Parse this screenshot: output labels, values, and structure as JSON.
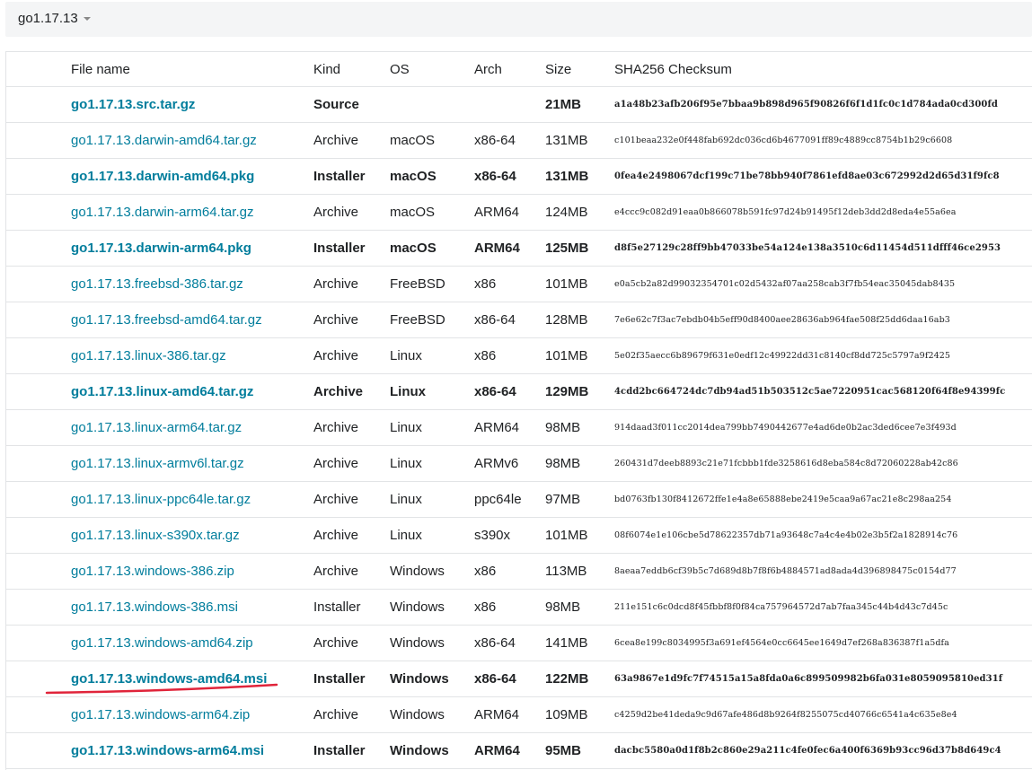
{
  "version_selector": {
    "label": "go1.17.13"
  },
  "table": {
    "headers": {
      "file_name": "File name",
      "kind": "Kind",
      "os": "OS",
      "arch": "Arch",
      "size": "Size",
      "checksum": "SHA256 Checksum"
    },
    "rows": [
      {
        "file": "go1.17.13.src.tar.gz",
        "kind": "Source",
        "os": "",
        "arch": "",
        "size": "21MB",
        "sha": "a1a48b23afb206f95e7bbaa9b898d965f90826f6f1d1fc0c1d784ada0cd300fd",
        "featured": true
      },
      {
        "file": "go1.17.13.darwin-amd64.tar.gz",
        "kind": "Archive",
        "os": "macOS",
        "arch": "x86-64",
        "size": "131MB",
        "sha": "c101beaa232e0f448fab692dc036cd6b4677091ff89c4889cc8754b1b29c6608",
        "featured": false
      },
      {
        "file": "go1.17.13.darwin-amd64.pkg",
        "kind": "Installer",
        "os": "macOS",
        "arch": "x86-64",
        "size": "131MB",
        "sha": "0fea4e2498067dcf199c71be78bb940f7861efd8ae03c672992d2d65d31f9fc8",
        "featured": true
      },
      {
        "file": "go1.17.13.darwin-arm64.tar.gz",
        "kind": "Archive",
        "os": "macOS",
        "arch": "ARM64",
        "size": "124MB",
        "sha": "e4ccc9c082d91eaa0b866078b591fc97d24b91495f12deb3dd2d8eda4e55a6ea",
        "featured": false
      },
      {
        "file": "go1.17.13.darwin-arm64.pkg",
        "kind": "Installer",
        "os": "macOS",
        "arch": "ARM64",
        "size": "125MB",
        "sha": "d8f5e27129c28ff9bb47033be54a124e138a3510c6d11454d511dfff46ce2953",
        "featured": true
      },
      {
        "file": "go1.17.13.freebsd-386.tar.gz",
        "kind": "Archive",
        "os": "FreeBSD",
        "arch": "x86",
        "size": "101MB",
        "sha": "e0a5cb2a82d99032354701c02d5432af07aa258cab3f7fb54eac35045dab8435",
        "featured": false
      },
      {
        "file": "go1.17.13.freebsd-amd64.tar.gz",
        "kind": "Archive",
        "os": "FreeBSD",
        "arch": "x86-64",
        "size": "128MB",
        "sha": "7e6e62c7f3ac7ebdb04b5eff90d8400aee28636ab964fae508f25dd6daa16ab3",
        "featured": false
      },
      {
        "file": "go1.17.13.linux-386.tar.gz",
        "kind": "Archive",
        "os": "Linux",
        "arch": "x86",
        "size": "101MB",
        "sha": "5e02f35aecc6b89679f631e0edf12c49922dd31c8140cf8dd725c5797a9f2425",
        "featured": false
      },
      {
        "file": "go1.17.13.linux-amd64.tar.gz",
        "kind": "Archive",
        "os": "Linux",
        "arch": "x86-64",
        "size": "129MB",
        "sha": "4cdd2bc664724dc7db94ad51b503512c5ae7220951cac568120f64f8e94399fc",
        "featured": true
      },
      {
        "file": "go1.17.13.linux-arm64.tar.gz",
        "kind": "Archive",
        "os": "Linux",
        "arch": "ARM64",
        "size": "98MB",
        "sha": "914daad3f011cc2014dea799bb7490442677e4ad6de0b2ac3ded6cee7e3f493d",
        "featured": false
      },
      {
        "file": "go1.17.13.linux-armv6l.tar.gz",
        "kind": "Archive",
        "os": "Linux",
        "arch": "ARMv6",
        "size": "98MB",
        "sha": "260431d7deeb8893c21e71fcbbb1fde3258616d8eba584c8d72060228ab42c86",
        "featured": false
      },
      {
        "file": "go1.17.13.linux-ppc64le.tar.gz",
        "kind": "Archive",
        "os": "Linux",
        "arch": "ppc64le",
        "size": "97MB",
        "sha": "bd0763fb130f8412672ffe1e4a8e65888ebe2419e5caa9a67ac21e8c298aa254",
        "featured": false
      },
      {
        "file": "go1.17.13.linux-s390x.tar.gz",
        "kind": "Archive",
        "os": "Linux",
        "arch": "s390x",
        "size": "101MB",
        "sha": "08f6074e1e106cbe5d78622357db71a93648c7a4c4e4b02e3b5f2a1828914c76",
        "featured": false
      },
      {
        "file": "go1.17.13.windows-386.zip",
        "kind": "Archive",
        "os": "Windows",
        "arch": "x86",
        "size": "113MB",
        "sha": "8aeaa7eddb6cf39b5c7d689d8b7f8f6b4884571ad8ada4d396898475c0154d77",
        "featured": false
      },
      {
        "file": "go1.17.13.windows-386.msi",
        "kind": "Installer",
        "os": "Windows",
        "arch": "x86",
        "size": "98MB",
        "sha": "211e151c6c0dcd8f45fbbf8f0f84ca757964572d7ab7faa345c44b4d43c7d45c",
        "featured": false
      },
      {
        "file": "go1.17.13.windows-amd64.zip",
        "kind": "Archive",
        "os": "Windows",
        "arch": "x86-64",
        "size": "141MB",
        "sha": "6cea8e199c8034995f3a691ef4564e0cc6645ee1649d7ef268a836387f1a5dfa",
        "featured": false
      },
      {
        "file": "go1.17.13.windows-amd64.msi",
        "kind": "Installer",
        "os": "Windows",
        "arch": "x86-64",
        "size": "122MB",
        "sha": "63a9867e1d9fc7f74515a15a8fda0a6c899509982b6fa031e8059095810ed31f",
        "featured": true
      },
      {
        "file": "go1.17.13.windows-arm64.zip",
        "kind": "Archive",
        "os": "Windows",
        "arch": "ARM64",
        "size": "109MB",
        "sha": "c4259d2be41deda9c9d67afe486d8b9264f8255075cd40766c6541a4c635e8e4",
        "featured": false
      },
      {
        "file": "go1.17.13.windows-arm64.msi",
        "kind": "Installer",
        "os": "Windows",
        "arch": "ARM64",
        "size": "95MB",
        "sha": "dacbc5580a0d1f8b2c860e29a211c4fe0fec6a400f6369b93cc96d37b8d649c4",
        "featured": true
      }
    ]
  },
  "colors": {
    "link": "#007d9c",
    "annotation_stroke": "#e0243a"
  }
}
